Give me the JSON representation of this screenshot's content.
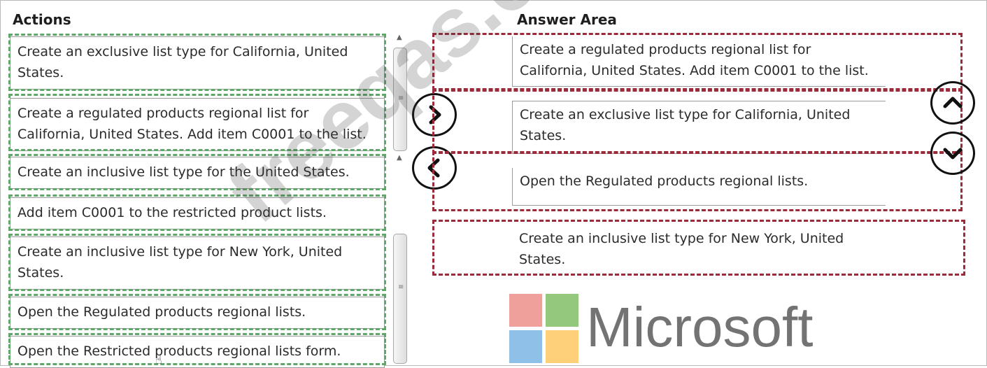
{
  "actions": {
    "title": "Actions",
    "items": [
      "Create an exclusive list type for California, United States.",
      "Create a regulated products regional list for California, United States. Add item C0001 to the list.",
      "Create an inclusive list type for the United States.",
      "Add item C0001 to the restricted product lists.",
      "Create an inclusive list type for New York, United States.",
      "Open the Regulated products regional lists.",
      "Open the Restricted products regional lists form."
    ]
  },
  "answer_area": {
    "title": "Answer Area",
    "items": [
      "Create a regulated products regional list for California, United States. Add item C0001 to the list.",
      "Create an exclusive list type for California, United States.",
      "Open the Regulated products regional lists.",
      "Create an inclusive list type for New York, United States."
    ]
  },
  "controls": {
    "move_right_icon": "chevron-right-icon",
    "move_left_icon": "chevron-left-icon",
    "move_up_icon": "chevron-up-icon",
    "move_down_icon": "chevron-down-icon"
  },
  "logo": {
    "text": "Microsoft",
    "colors": [
      "#f25022",
      "#7fba00",
      "#00a4ef",
      "#ffb900"
    ]
  },
  "watermark": {
    "text": "freeqas.com"
  }
}
